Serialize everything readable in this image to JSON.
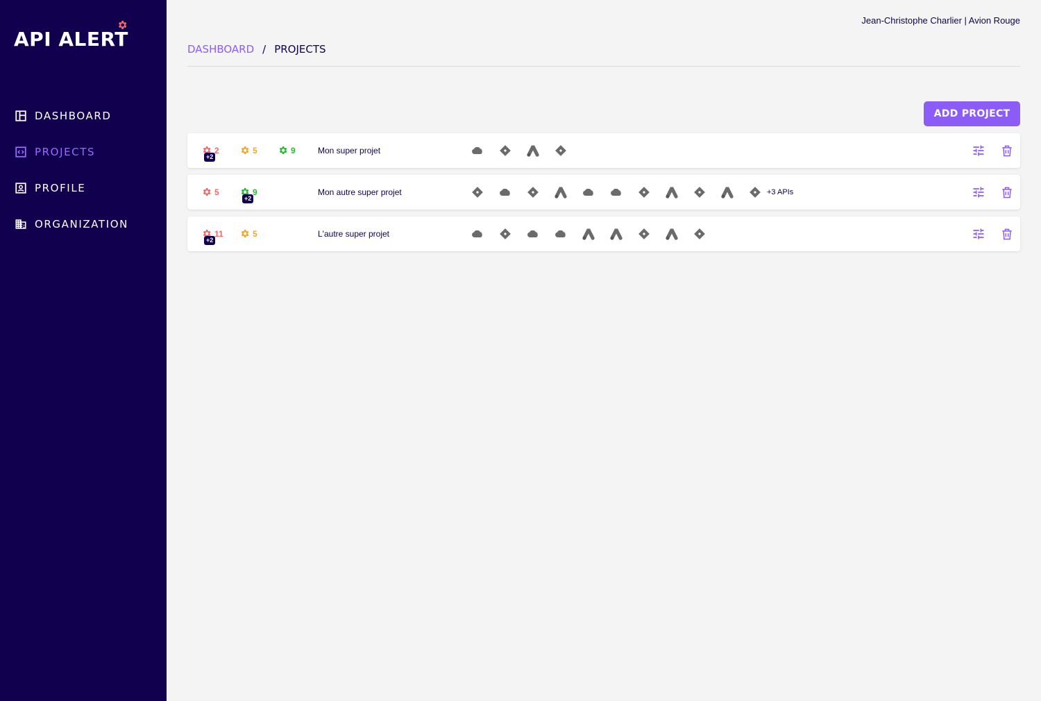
{
  "brand": {
    "name": "API ALERT",
    "accent": "#8b5cf6",
    "sidebar_bg": "#10004e"
  },
  "user": {
    "display": "Jean-Christophe Charlier | Avion Rouge"
  },
  "nav": [
    {
      "label": "DASHBOARD",
      "icon": "dashboard-icon"
    },
    {
      "label": "PROJECTS",
      "icon": "code-icon",
      "active": true
    },
    {
      "label": "PROFILE",
      "icon": "profile-icon"
    },
    {
      "label": "ORGANIZATION",
      "icon": "building-icon"
    }
  ],
  "breadcrumb": {
    "parent": "DASHBOARD",
    "separator": "/",
    "current": "PROJECTS"
  },
  "add_button": {
    "label": "ADD PROJECT"
  },
  "projects": [
    {
      "name": "Mon super projet",
      "alerts": [
        {
          "level": "red",
          "count": "2",
          "extra": "+2"
        },
        {
          "level": "orange",
          "count": "5"
        },
        {
          "level": "green",
          "count": "9"
        }
      ],
      "apis": [
        "cloud-icon",
        "diamond-icon",
        "peak-icon",
        "diamond-icon"
      ],
      "more": ""
    },
    {
      "name": "Mon autre super projet",
      "alerts": [
        {
          "level": "red",
          "count": "5"
        },
        {
          "level": "green",
          "count": "9",
          "extra": "+2"
        }
      ],
      "apis": [
        "diamond-icon",
        "cloud-icon",
        "diamond-icon",
        "peak-icon",
        "cloud-icon",
        "cloud-icon",
        "diamond-icon",
        "peak-icon",
        "diamond-icon",
        "peak-icon",
        "diamond-icon"
      ],
      "more": "+3 APIs"
    },
    {
      "name": "L'autre super projet",
      "alerts": [
        {
          "level": "red",
          "count": "11",
          "extra": "+2"
        },
        {
          "level": "orange",
          "count": "5"
        }
      ],
      "apis": [
        "cloud-icon",
        "diamond-icon",
        "cloud-icon",
        "cloud-icon",
        "peak-icon",
        "peak-icon",
        "diamond-icon",
        "peak-icon",
        "diamond-icon"
      ],
      "more": ""
    }
  ]
}
